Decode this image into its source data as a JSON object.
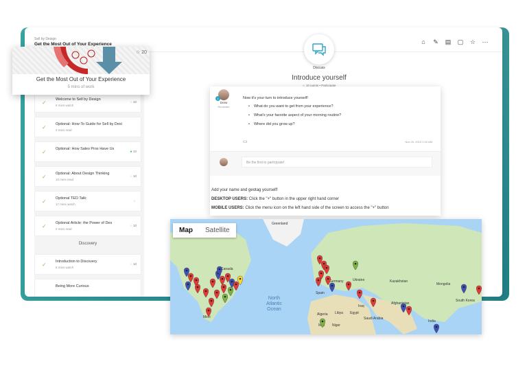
{
  "app": {
    "breadcrumb_small": "Sell by Design",
    "breadcrumb_title": "Get the Most Out of Your Experience",
    "toolbar": [
      "home-icon",
      "paperclip-icon",
      "notes-icon",
      "chat-icon",
      "star-icon",
      "more-icon"
    ]
  },
  "module": {
    "title": "Get the Most Out of Your Experience",
    "subtitle": "5 mins of work",
    "star_count": "20"
  },
  "course_list": {
    "items": [
      {
        "title": "Welcome to Sell by Design",
        "sub": "5 mins watch",
        "pts": "10",
        "star": "gray"
      },
      {
        "title": "Optional: How-To Guide for Sell by Desi",
        "sub": "3 mins read",
        "pts": "",
        "star": "none"
      },
      {
        "title": "Optional: How Sales Pros Have Us",
        "sub": "",
        "pts": "10",
        "star": "green"
      },
      {
        "title": "Optional: About Design Thinking",
        "sub": "10 mins read",
        "pts": "10",
        "star": "gray"
      },
      {
        "title": "Optional TED Talk:",
        "sub": "17 mins watch",
        "pts": "",
        "star": "gray"
      },
      {
        "title": "Optional Article: the Power of Des",
        "sub": "2 mins read",
        "pts": "10",
        "star": "gray"
      }
    ],
    "section_label": "Discovery",
    "discovery_items": [
      {
        "title": "Introduction to Discovery",
        "sub": "5 mins watch",
        "pts": "10",
        "star": "gray"
      },
      {
        "title": "Being More Curious",
        "sub": "",
        "pts": "",
        "star": "none"
      }
    ]
  },
  "discuss": {
    "label": "Discuss",
    "title": "Introduce yourself",
    "points": "10 points",
    "participate": "Participate",
    "author_name": "Drew",
    "author_role": "Reminder",
    "author_badge": "1",
    "intro_text": "Now it's your turn to introduce yourself!",
    "bullets": [
      "What do you want to get from your experience?",
      "What's your favorite aspect of your morning routine?",
      "Where did you grow up?"
    ],
    "date": "Nov 20, 2019 2:20 AM",
    "reply_placeholder": "Be the first to participate!",
    "instruction_1": "Add your name and geotag yourself!",
    "desktop_label": "DESKTOP USERS:",
    "desktop_text": " Click the \"+\" button in the upper right hand corner",
    "mobile_label": "MOBILE USERS:",
    "mobile_text": " Click the menu icon on the left hand side of the screen to access the \"+\" button"
  },
  "map": {
    "tab_map": "Map",
    "tab_satellite": "Satellite",
    "labels": {
      "greenland": "Greenland",
      "canada": "Canada",
      "ocean_1": "North",
      "ocean_2": "Atlantic",
      "ocean_3": "Ocean",
      "mexico": "Mexi",
      "spain": "Spain",
      "germany": "Germany",
      "ukraine": "Ukraine",
      "kazakhstan": "Kazakhstan",
      "mongolia": "Mongolia",
      "afghanistan": "Afghanistan",
      "saudi": "Saudi Arabia",
      "egypt": "Egypt",
      "libya": "Libya",
      "mali": "Mali",
      "niger": "Niger",
      "india": "India",
      "south_korea": "South Korea",
      "iraq": "Iraq",
      "algeria": "Algeria"
    },
    "pin_colors": {
      "red": "#e53935",
      "blue": "#3f51b5",
      "green": "#7cb342",
      "yellow": "#fdd835"
    }
  }
}
